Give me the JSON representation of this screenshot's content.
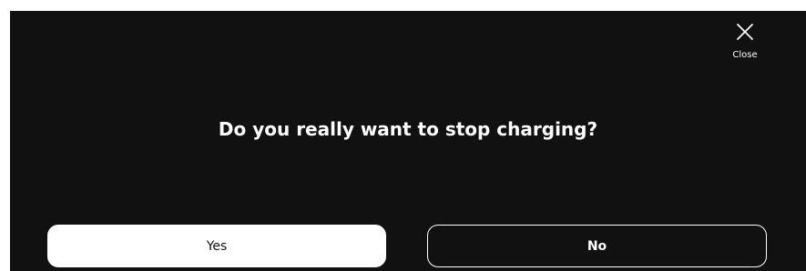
{
  "dialog": {
    "close_label": "Close",
    "close_icon": "close-icon",
    "question": "Do you really want to stop charging?",
    "yes_label": "Yes",
    "no_label": "No"
  },
  "colors": {
    "background": "#111111",
    "text": "#ffffff",
    "primary_button_bg": "#ffffff",
    "primary_button_text": "#111111",
    "secondary_button_border": "#ffffff"
  }
}
